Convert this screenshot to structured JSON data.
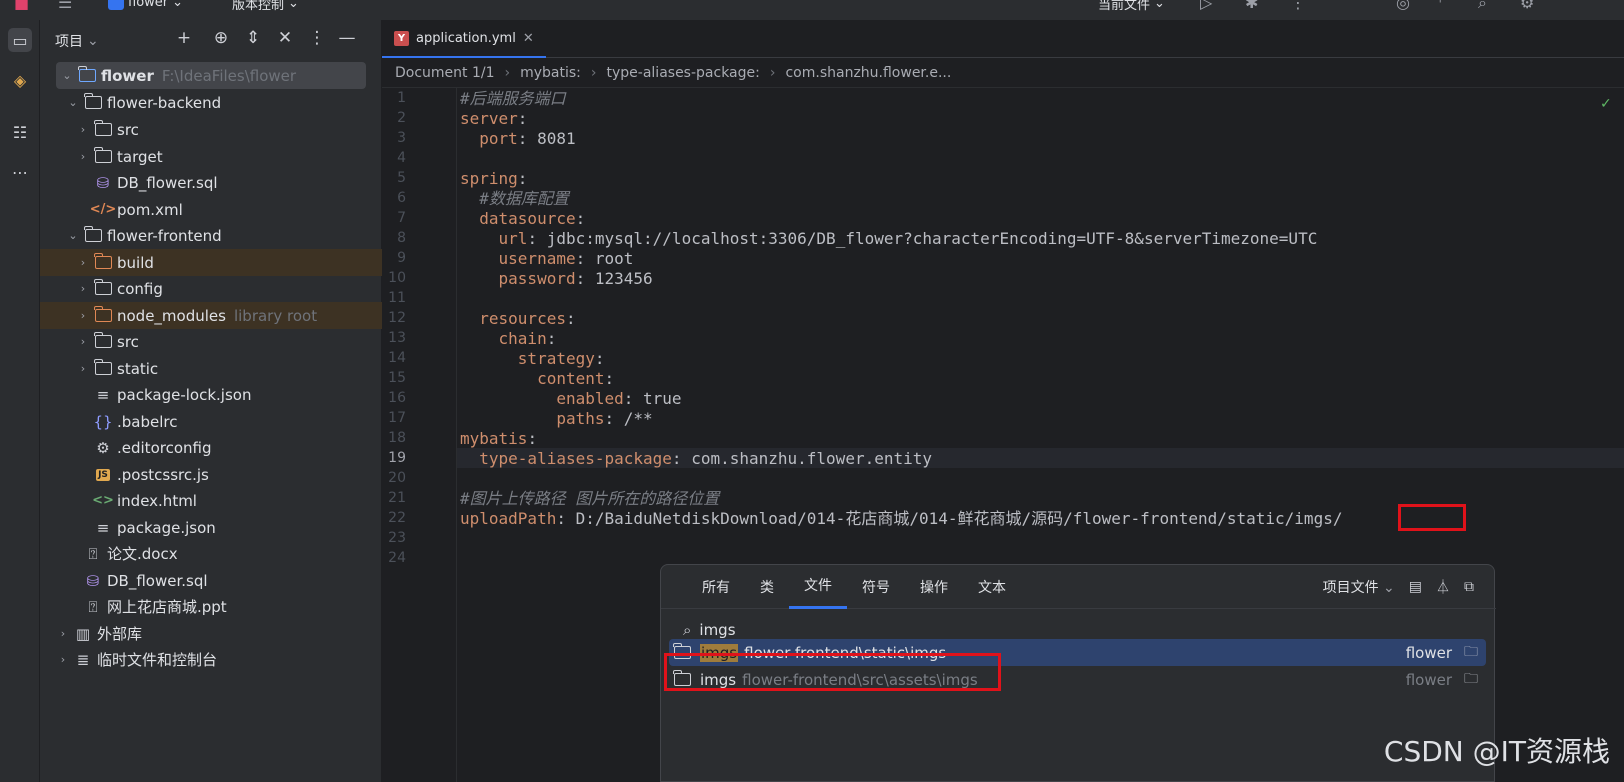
{
  "topbar": {
    "project_name": "flower",
    "vcs": "版本控制",
    "run_config": "当前文件"
  },
  "project_panel": {
    "title": "项目",
    "tree": [
      {
        "label": "flower",
        "extra": "F:\\IdeaFiles\\flower"
      },
      {
        "label": "flower-backend"
      },
      {
        "label": "src"
      },
      {
        "label": "target"
      },
      {
        "label": "DB_flower.sql"
      },
      {
        "label": "pom.xml"
      },
      {
        "label": "flower-frontend"
      },
      {
        "label": "build"
      },
      {
        "label": "config"
      },
      {
        "label": "node_modules",
        "extra": "library root"
      },
      {
        "label": "src"
      },
      {
        "label": "static"
      },
      {
        "label": "package-lock.json"
      },
      {
        "label": ".babelrc"
      },
      {
        "label": ".editorconfig"
      },
      {
        "label": ".postcssrc.js"
      },
      {
        "label": "index.html"
      },
      {
        "label": "package.json"
      },
      {
        "label": "论文.docx"
      },
      {
        "label": "DB_flower.sql"
      },
      {
        "label": "网上花店商城.ppt"
      },
      {
        "label": "外部库"
      },
      {
        "label": "临时文件和控制台"
      }
    ]
  },
  "editor": {
    "tab": "application.yml",
    "breadcrumbs": [
      "Document 1/1",
      "mybatis:",
      "type-aliases-package:",
      "com.shanzhu.flower.e..."
    ],
    "line_numbers": [
      "1",
      "2",
      "3",
      "4",
      "5",
      "6",
      "7",
      "8",
      "9",
      "10",
      "11",
      "12",
      "13",
      "14",
      "15",
      "16",
      "17",
      "18",
      "19",
      "20",
      "21",
      "22",
      "23",
      "24"
    ],
    "current_line": "19",
    "code": {
      "l1": "#后端服务端口",
      "l2_key": "server",
      "l3_key": "port",
      "l3_val": "8081",
      "l5_key": "spring",
      "l6": "#数据库配置",
      "l7_key": "datasource",
      "l8_key": "url",
      "l8_val": "jdbc:mysql://localhost:3306/DB_flower?characterEncoding=UTF-8&serverTimezone=UTC",
      "l9_key": "username",
      "l9_val": "root",
      "l10_key": "password",
      "l10_val": "123456",
      "l12_key": "resources",
      "l13_key": "chain",
      "l14_key": "strategy",
      "l15_key": "content",
      "l16_key": "enabled",
      "l16_val": "true",
      "l17_key": "paths",
      "l17_val": "/**",
      "l18_key": "mybatis",
      "l19_key": "type-aliases-package",
      "l19_val": "com.shanzhu.flower.entity",
      "l21": "#图片上传路径 图片所在的路径位置",
      "l22_key": "uploadPath",
      "l22_val": "D:/BaiduNetdiskDownload/014-花店商城/014-鲜花商城/源码/flower-frontend/static/imgs/"
    }
  },
  "search_popup": {
    "tabs": [
      "所有",
      "类",
      "文件",
      "符号",
      "操作",
      "文本"
    ],
    "active_tab": "文件",
    "scope": "项目文件",
    "query": "imgs",
    "results": [
      {
        "name": "imgs",
        "path": "flower-frontend\\static\\imgs",
        "project": "flower"
      },
      {
        "name": "imgs",
        "path": "flower-frontend\\src\\assets\\imgs",
        "project": "flower"
      }
    ]
  },
  "watermark": "CSDN @IT资源栈",
  "colors": {
    "accent": "#3574f0",
    "annotation_red": "#e0121a",
    "keyword": "#cf8e6d"
  }
}
